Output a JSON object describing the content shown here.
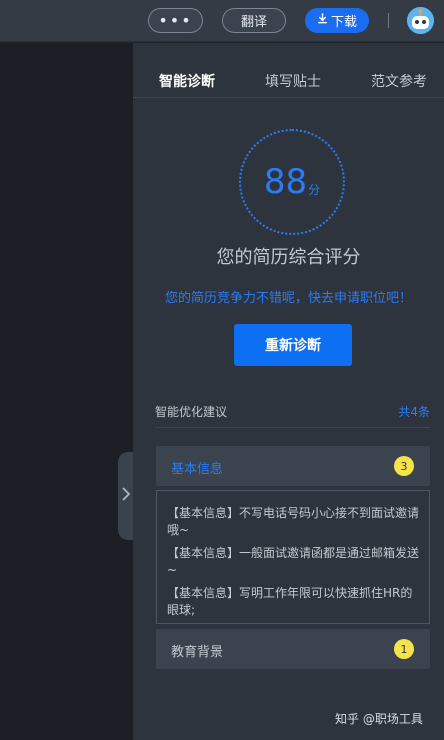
{
  "topbar": {
    "more_label": "•••",
    "translate_label": "翻译",
    "download_label": "下载",
    "download_icon": "download-icon",
    "avatar_icon": "robot-avatar-icon"
  },
  "panel": {
    "tabs": [
      {
        "label": "智能诊断",
        "active": true
      },
      {
        "label": "填写贴士",
        "active": false
      },
      {
        "label": "范文参考",
        "active": false
      }
    ],
    "score": {
      "value": "88",
      "unit": "分"
    },
    "score_title": "您的简历综合评分",
    "score_desc": "您的简历竞争力不错呢，快去申请职位吧！",
    "rediagnose_label": "重新诊断",
    "suggestions": {
      "heading": "智能优化建议",
      "count": "共4条",
      "sections": [
        {
          "title": "基本信息",
          "badge": "3",
          "tips": [
            "【基本信息】不写电话号码小心接不到面试邀请哦~",
            "【基本信息】一般面试邀请函都是通过邮箱发送~",
            "【基本信息】写明工作年限可以快速抓住HR的眼球;"
          ]
        },
        {
          "title": "教育背景",
          "badge": "1"
        }
      ]
    }
  },
  "watermark": "知乎 @职场工具",
  "colors": {
    "accent": "#0d6ff2",
    "accent_text": "#2b7bf3",
    "badge": "#f5e34b",
    "panel_bg": "#2e343d",
    "topbar_bg": "#343b45"
  }
}
